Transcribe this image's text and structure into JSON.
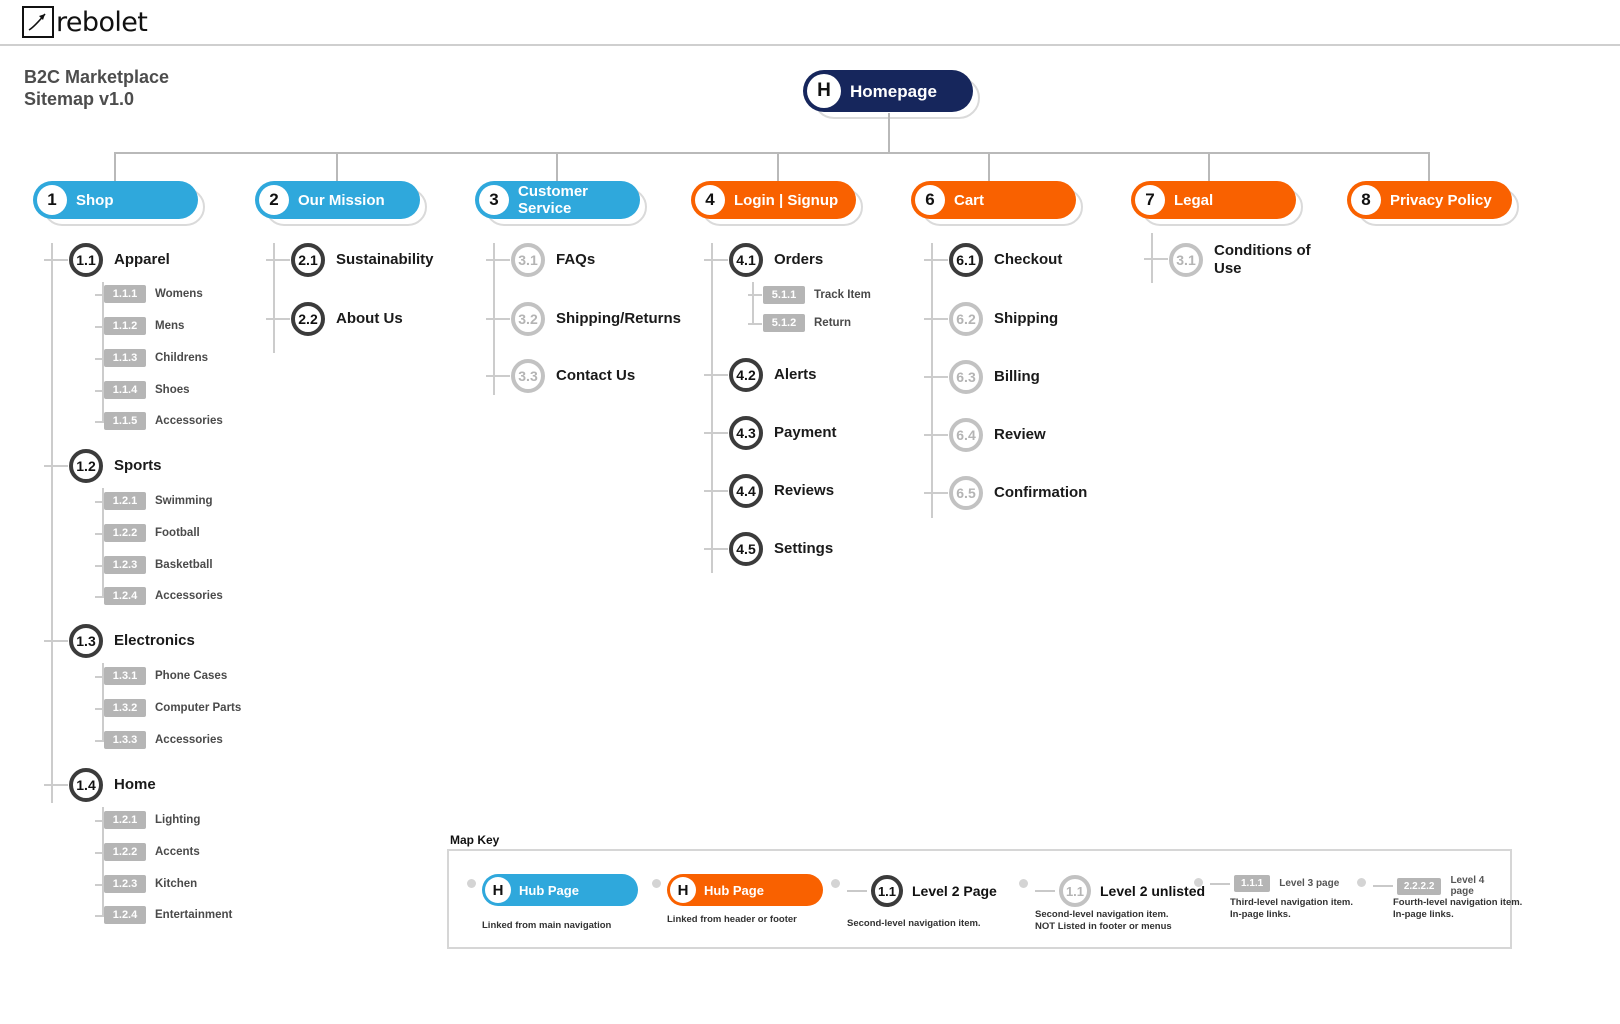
{
  "brand": {
    "logo_icon": "rebolet-logo-icon",
    "name": "rebolet"
  },
  "document": {
    "title_line1": "B2C Marketplace",
    "title_line2": "Sitemap v1.0"
  },
  "colors": {
    "home": "#16265c",
    "blue": "#2fa8dc",
    "orange": "#f96100",
    "node_dark": "#3b3b3b",
    "node_muted": "#c2c2c2",
    "tag_gray": "#b5b5b5",
    "connector": "#b9b9b9"
  },
  "root": {
    "badge": "H",
    "label": "Homepage",
    "style": "home"
  },
  "hubs": [
    {
      "badge": "1",
      "label": "Shop",
      "style": "blue"
    },
    {
      "badge": "2",
      "label": "Our Mission",
      "style": "blue"
    },
    {
      "badge": "3",
      "label": "Customer Service",
      "style": "blue"
    },
    {
      "badge": "4",
      "label": "Login | Signup",
      "style": "orange"
    },
    {
      "badge": "6",
      "label": "Cart",
      "style": "orange"
    },
    {
      "badge": "7",
      "label": "Legal",
      "style": "orange"
    },
    {
      "badge": "8",
      "label": "Privacy Policy",
      "style": "orange"
    }
  ],
  "shop": {
    "apparel": {
      "num": "1.1",
      "label": "Apparel",
      "muted": false,
      "children": [
        {
          "tag": "1.1.1",
          "label": "Womens"
        },
        {
          "tag": "1.1.2",
          "label": "Mens"
        },
        {
          "tag": "1.1.3",
          "label": "Childrens"
        },
        {
          "tag": "1.1.4",
          "label": "Shoes"
        },
        {
          "tag": "1.1.5",
          "label": "Accessories"
        }
      ]
    },
    "sports": {
      "num": "1.2",
      "label": "Sports",
      "muted": false,
      "children": [
        {
          "tag": "1.2.1",
          "label": "Swimming"
        },
        {
          "tag": "1.2.2",
          "label": "Football"
        },
        {
          "tag": "1.2.3",
          "label": "Basketball"
        },
        {
          "tag": "1.2.4",
          "label": "Accessories"
        }
      ]
    },
    "electronics": {
      "num": "1.3",
      "label": "Electronics",
      "muted": false,
      "children": [
        {
          "tag": "1.3.1",
          "label": "Phone Cases"
        },
        {
          "tag": "1.3.2",
          "label": "Computer Parts"
        },
        {
          "tag": "1.3.3",
          "label": "Accessories"
        }
      ]
    },
    "home": {
      "num": "1.4",
      "label": "Home",
      "muted": false,
      "children": [
        {
          "tag": "1.2.1",
          "label": "Lighting"
        },
        {
          "tag": "1.2.2",
          "label": "Accents"
        },
        {
          "tag": "1.2.3",
          "label": "Kitchen"
        },
        {
          "tag": "1.2.4",
          "label": "Entertainment"
        }
      ]
    }
  },
  "mission": [
    {
      "num": "2.1",
      "label": "Sustainability",
      "muted": false
    },
    {
      "num": "2.2",
      "label": "About Us",
      "muted": false
    }
  ],
  "customer_service": [
    {
      "num": "3.1",
      "label": "FAQs",
      "muted": true
    },
    {
      "num": "3.2",
      "label": "Shipping/Returns",
      "muted": true
    },
    {
      "num": "3.3",
      "label": "Contact Us",
      "muted": true
    }
  ],
  "login": {
    "orders": {
      "num": "4.1",
      "label": "Orders",
      "muted": false,
      "children": [
        {
          "tag": "5.1.1",
          "label": "Track Item"
        },
        {
          "tag": "5.1.2",
          "label": "Return"
        }
      ]
    },
    "rest": [
      {
        "num": "4.2",
        "label": "Alerts",
        "muted": false
      },
      {
        "num": "4.3",
        "label": "Payment",
        "muted": false
      },
      {
        "num": "4.4",
        "label": "Reviews",
        "muted": false
      },
      {
        "num": "4.5",
        "label": "Settings",
        "muted": false
      }
    ]
  },
  "cart": [
    {
      "num": "6.1",
      "label": "Checkout",
      "muted": false
    },
    {
      "num": "6.2",
      "label": "Shipping",
      "muted": true
    },
    {
      "num": "6.3",
      "label": "Billing",
      "muted": true
    },
    {
      "num": "6.4",
      "label": "Review",
      "muted": true
    },
    {
      "num": "6.5",
      "label": "Confirmation",
      "muted": true
    }
  ],
  "legal": [
    {
      "num": "3.1",
      "label": "Conditions of Use",
      "muted": true
    }
  ],
  "map_key": {
    "title": "Map Key",
    "items": [
      {
        "kind": "pill",
        "style": "blue",
        "badge": "H",
        "label": "Hub Page",
        "caption": "Linked from main navigation"
      },
      {
        "kind": "pill",
        "style": "orange",
        "badge": "H",
        "label": "Hub Page",
        "caption": "Linked from header or footer"
      },
      {
        "kind": "circle",
        "muted": false,
        "num": "1.1",
        "label": "Level 2 Page",
        "caption": "Second-level navigation item."
      },
      {
        "kind": "circle",
        "muted": true,
        "num": "1.1",
        "label": "Level 2 unlisted",
        "caption": "Second-level navigation item.\nNOT Listed in footer or menus"
      },
      {
        "kind": "tag",
        "tag": "1.1.1",
        "label": "Level 3 page",
        "caption": "Third-level navigation item.\nIn-page links."
      },
      {
        "kind": "tag",
        "tag": "2.2.2.2",
        "label": "Level 4 page",
        "caption": "Fourth-level navigation item.\nIn-page links."
      }
    ]
  }
}
